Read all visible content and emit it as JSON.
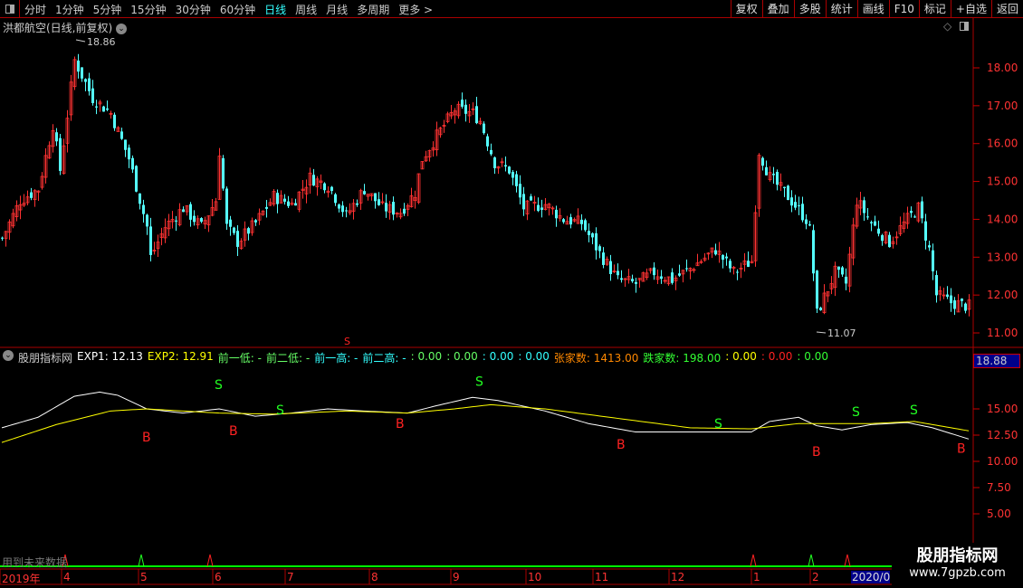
{
  "toolbar": {
    "periods": [
      "分时",
      "1分钟",
      "5分钟",
      "15分钟",
      "30分钟",
      "60分钟",
      "日线",
      "周线",
      "月线",
      "多周期",
      "更多 >"
    ],
    "active": "日线",
    "actions": [
      "复权",
      "叠加",
      "多股",
      "统计",
      "画线",
      "F10",
      "标记",
      "+自选",
      "返回"
    ]
  },
  "stock": {
    "title": "洪都航空(日线,前复权)",
    "high_label": "18.86",
    "low_label": "11.07"
  },
  "price_axis": {
    "ticks": [
      "18.00",
      "17.00",
      "16.00",
      "15.00",
      "14.00",
      "13.00",
      "12.00",
      "11.00"
    ],
    "min": 10.8,
    "max": 19.2
  },
  "indicator": {
    "name": "股朋指标网",
    "exp1": "EXP1: 12.13",
    "exp2": "EXP2: 12.91",
    "low1": "前一低: -",
    "low2": "前二低: -",
    "high1": "前一高: -",
    "high2": "前二高: -",
    "v1": ": 0.00",
    "v2": ": 0.00",
    "v3": ": 0.00",
    "v4": ": 0.00",
    "rise": "张家数: 1413.00",
    "fall": "跌家数: 198.00",
    "v5": ": 0.00",
    "v6": ": 0.00",
    "v7": ": 0.00",
    "axis_box": "18.88",
    "ticks": [
      "15.00",
      "12.50",
      "10.00",
      "7.50",
      "5.00"
    ],
    "signals": [
      {
        "t": "B",
        "bar": 40,
        "v": 11.9
      },
      {
        "t": "S",
        "bar": 60,
        "v": 16.9
      },
      {
        "t": "B",
        "bar": 64,
        "v": 12.5
      },
      {
        "t": "S",
        "bar": 77,
        "v": 14.5
      },
      {
        "t": "B",
        "bar": 110,
        "v": 13.2
      },
      {
        "t": "S",
        "bar": 132,
        "v": 17.2
      },
      {
        "t": "B",
        "bar": 171,
        "v": 11.2
      },
      {
        "t": "S",
        "bar": 198,
        "v": 13.2
      },
      {
        "t": "B",
        "bar": 225,
        "v": 10.5
      },
      {
        "t": "S",
        "bar": 236,
        "v": 14.3
      },
      {
        "t": "S",
        "bar": 252,
        "v": 14.5
      },
      {
        "t": "B",
        "bar": 265,
        "v": 10.8
      }
    ],
    "exp1_points": [
      [
        0,
        13.2
      ],
      [
        10,
        14.2
      ],
      [
        20,
        16.2
      ],
      [
        27,
        16.6
      ],
      [
        32,
        16.3
      ],
      [
        40,
        15.0
      ],
      [
        50,
        14.6
      ],
      [
        60,
        15.0
      ],
      [
        70,
        14.3
      ],
      [
        80,
        14.6
      ],
      [
        90,
        15.0
      ],
      [
        100,
        14.8
      ],
      [
        112,
        14.6
      ],
      [
        120,
        15.3
      ],
      [
        130,
        16.1
      ],
      [
        137,
        15.8
      ],
      [
        150,
        14.8
      ],
      [
        162,
        13.6
      ],
      [
        175,
        12.8
      ],
      [
        190,
        12.8
      ],
      [
        207,
        12.8
      ],
      [
        212,
        13.8
      ],
      [
        220,
        14.2
      ],
      [
        225,
        13.4
      ],
      [
        232,
        13.0
      ],
      [
        240,
        13.5
      ],
      [
        250,
        13.7
      ],
      [
        257,
        13.2
      ],
      [
        267,
        12.13
      ]
    ],
    "exp2_points": [
      [
        0,
        11.8
      ],
      [
        15,
        13.5
      ],
      [
        30,
        14.8
      ],
      [
        40,
        15.0
      ],
      [
        60,
        14.6
      ],
      [
        75,
        14.5
      ],
      [
        95,
        14.8
      ],
      [
        112,
        14.6
      ],
      [
        125,
        15.0
      ],
      [
        135,
        15.4
      ],
      [
        150,
        15.0
      ],
      [
        170,
        14.1
      ],
      [
        190,
        13.2
      ],
      [
        207,
        13.1
      ],
      [
        220,
        13.6
      ],
      [
        240,
        13.6
      ],
      [
        252,
        13.8
      ],
      [
        267,
        12.91
      ]
    ]
  },
  "price_points": [
    [
      0,
      13.5
    ],
    [
      5,
      14.5
    ],
    [
      10,
      14.8
    ],
    [
      14,
      16.5
    ],
    [
      16,
      15.3
    ],
    [
      20,
      18.2
    ],
    [
      25,
      17.2
    ],
    [
      30,
      16.8
    ],
    [
      35,
      15.6
    ],
    [
      40,
      13.8
    ],
    [
      41,
      13.0
    ],
    [
      45,
      13.8
    ],
    [
      50,
      14.3
    ],
    [
      55,
      13.8
    ],
    [
      59,
      14.5
    ],
    [
      60,
      15.8
    ],
    [
      62,
      13.8
    ],
    [
      65,
      13.4
    ],
    [
      70,
      13.9
    ],
    [
      75,
      14.6
    ],
    [
      80,
      14.4
    ],
    [
      85,
      15.1
    ],
    [
      90,
      14.9
    ],
    [
      95,
      14.1
    ],
    [
      100,
      14.8
    ],
    [
      105,
      14.3
    ],
    [
      110,
      14.2
    ],
    [
      114,
      14.7
    ],
    [
      116,
      15.6
    ],
    [
      120,
      16.2
    ],
    [
      125,
      16.9
    ],
    [
      130,
      16.8
    ],
    [
      132,
      16.6
    ],
    [
      136,
      15.5
    ],
    [
      140,
      15.3
    ],
    [
      144,
      14.3
    ],
    [
      150,
      14.4
    ],
    [
      155,
      14.0
    ],
    [
      160,
      13.9
    ],
    [
      165,
      13.1
    ],
    [
      170,
      12.4
    ],
    [
      175,
      12.3
    ],
    [
      180,
      12.6
    ],
    [
      185,
      12.4
    ],
    [
      190,
      12.7
    ],
    [
      197,
      13.2
    ],
    [
      202,
      12.6
    ],
    [
      207,
      12.9
    ],
    [
      209,
      15.8
    ],
    [
      212,
      15.1
    ],
    [
      217,
      14.6
    ],
    [
      222,
      14.0
    ],
    [
      223,
      13.7
    ],
    [
      225,
      11.5
    ],
    [
      230,
      12.6
    ],
    [
      233,
      12.3
    ],
    [
      236,
      14.5
    ],
    [
      240,
      13.9
    ],
    [
      245,
      13.4
    ],
    [
      250,
      14.0
    ],
    [
      253,
      14.3
    ],
    [
      256,
      13.2
    ],
    [
      258,
      12.0
    ],
    [
      262,
      11.8
    ],
    [
      267,
      11.7
    ]
  ],
  "spikes": [
    {
      "bar": 18,
      "c": "red"
    },
    {
      "bar": 39,
      "c": "green"
    },
    {
      "bar": 58,
      "c": "red"
    },
    {
      "bar": 208,
      "c": "red"
    },
    {
      "bar": 224,
      "c": "green"
    },
    {
      "bar": 234,
      "c": "red"
    }
  ],
  "footer": {
    "future_label": "用到未来数据",
    "dates": [
      [
        "2019年",
        2
      ],
      [
        "4",
        70
      ],
      [
        "5",
        155
      ],
      [
        "6",
        237
      ],
      [
        "7",
        317
      ],
      [
        "8",
        410
      ],
      [
        "9",
        500
      ],
      [
        "10",
        583
      ],
      [
        "11",
        657
      ],
      [
        "12",
        741
      ],
      [
        "1",
        832
      ],
      [
        "2",
        897
      ]
    ],
    "date_box": "2020/0"
  },
  "watermark": {
    "name": "股朋指标网",
    "url": "www.7gpzb.com"
  },
  "colors": {
    "up": "#ff3232",
    "down": "#54ffff",
    "exp1": "#ffffff",
    "exp2": "#ffff00",
    "grid": "#a00000"
  }
}
